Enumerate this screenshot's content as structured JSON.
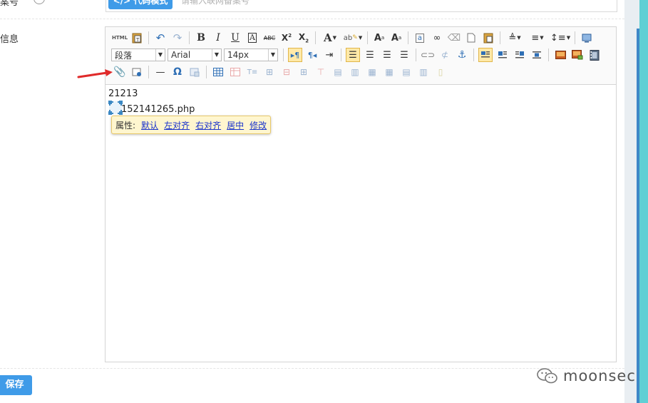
{
  "top": {
    "label": "案号",
    "help": "?",
    "mode_button": "</> 代码模式",
    "placeholder": "请输入联网备案号"
  },
  "form": {
    "info_label": "信息"
  },
  "editor": {
    "paragraph_select": "段落",
    "font_select": "Arial",
    "size_select": "14px",
    "content_line1": "21213",
    "content_line2": "152141265.php"
  },
  "popup": {
    "label": "属性:",
    "links": [
      "默认",
      "左对齐",
      "右对齐",
      "居中",
      "修改"
    ]
  },
  "actions": {
    "save": "保存"
  },
  "watermark": {
    "text": "moonsec"
  },
  "colors": {
    "accent": "#3f9be8",
    "popup_bg": "#fff6cf",
    "arrow": "#e02a2a"
  }
}
